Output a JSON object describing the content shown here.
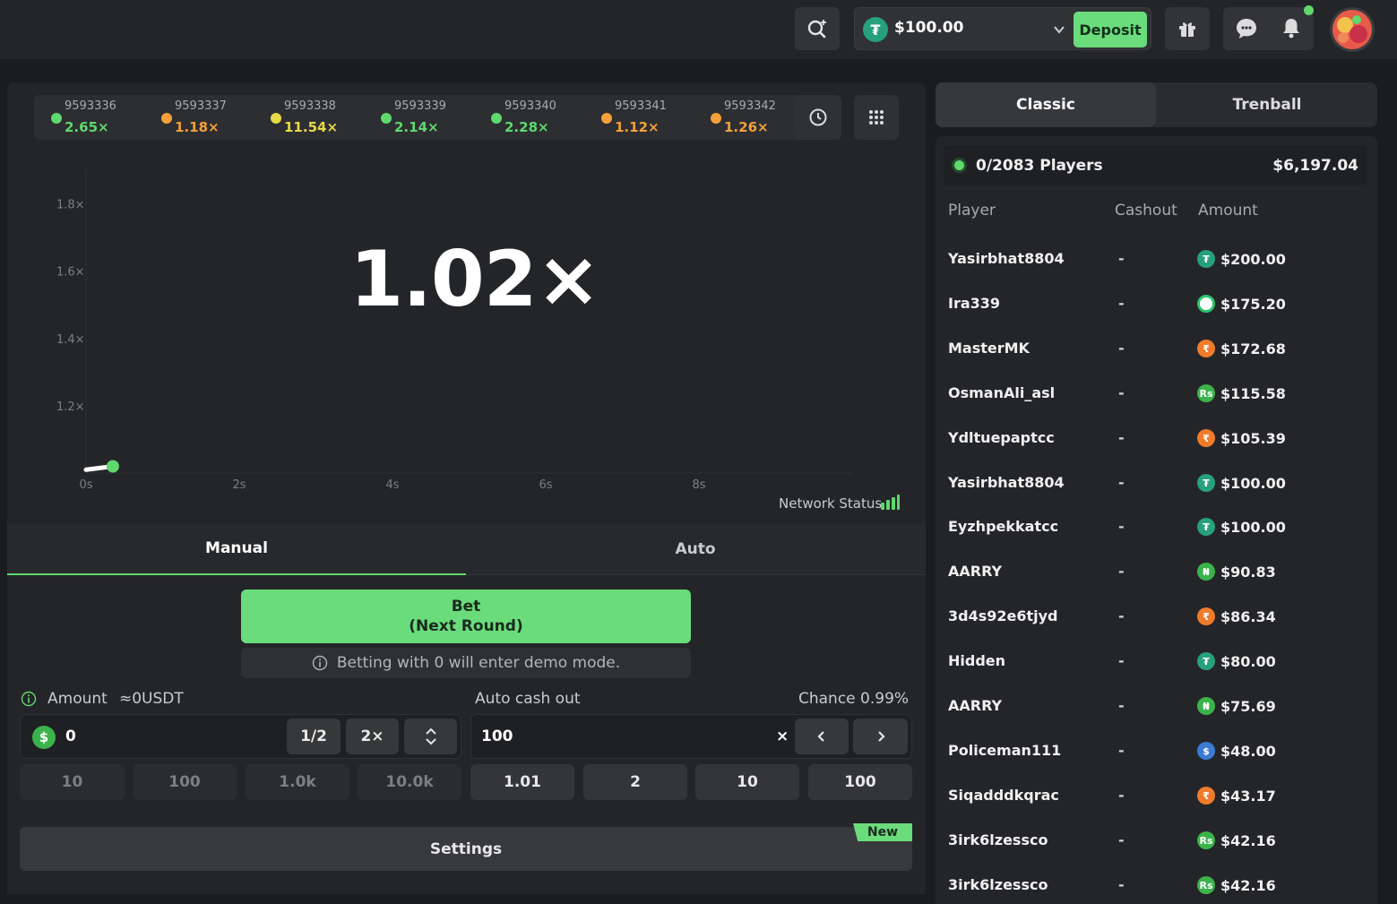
{
  "topbar": {
    "balance": "$100.00",
    "deposit_label": "Deposit",
    "currency_symbol": "₮"
  },
  "history": [
    {
      "id": "9593336",
      "mult": "2.65×",
      "color": "#5fd86e"
    },
    {
      "id": "9593337",
      "mult": "1.18×",
      "color": "#f5a03a"
    },
    {
      "id": "9593338",
      "mult": "11.54×",
      "color": "#e6d94a"
    },
    {
      "id": "9593339",
      "mult": "2.14×",
      "color": "#5fd86e"
    },
    {
      "id": "9593340",
      "mult": "2.28×",
      "color": "#5fd86e"
    },
    {
      "id": "9593341",
      "mult": "1.12×",
      "color": "#f5a03a"
    },
    {
      "id": "9593342",
      "mult": "1.26×",
      "color": "#f5a03a"
    }
  ],
  "game": {
    "current_multiplier": "1.02×",
    "network_status_label": "Network Status"
  },
  "chart_data": {
    "type": "line",
    "x_ticks": [
      "0s",
      "2s",
      "4s",
      "6s",
      "8s"
    ],
    "y_ticks": [
      "1.2×",
      "1.4×",
      "1.6×",
      "1.8×"
    ],
    "xlim": [
      0,
      10
    ],
    "ylim": [
      1.0,
      1.9
    ],
    "series": [
      {
        "x": [
          0,
          0.35
        ],
        "y": [
          1.01,
          1.02
        ]
      }
    ]
  },
  "bet_tabs": {
    "manual": "Manual",
    "auto": "Auto"
  },
  "bet": {
    "button_line1": "Bet",
    "button_line2": "(Next Round)",
    "demo_note": "Betting with 0 will enter demo mode."
  },
  "amount": {
    "label": "Amount",
    "approx": "≈0USDT",
    "value": "0",
    "currency_symbol": "$",
    "half": "1/2",
    "double": "2×",
    "quick": [
      "10",
      "100",
      "1.0k",
      "10.0k"
    ]
  },
  "autocashout": {
    "label": "Auto cash out",
    "chance": "Chance 0.99%",
    "value": "100",
    "suffix": "×",
    "quick": [
      "1.01",
      "2",
      "10",
      "100"
    ]
  },
  "settings": {
    "label": "Settings",
    "badge": "New"
  },
  "right_tabs": {
    "classic": "Classic",
    "trenball": "Trenball"
  },
  "players": {
    "count": "0/2083 Players",
    "total": "$6,197.04",
    "headers": {
      "player": "Player",
      "cashout": "Cashout",
      "amount": "Amount"
    },
    "rows": [
      {
        "name": "Yasirbhat8804",
        "cashout": "-",
        "amount": "$200.00",
        "coin": "t",
        "glyph": "₮"
      },
      {
        "name": "Ira339",
        "cashout": "-",
        "amount": "$175.20",
        "coin": "ring",
        "glyph": ""
      },
      {
        "name": "MasterMK",
        "cashout": "-",
        "amount": "$172.68",
        "coin": "o",
        "glyph": "₹"
      },
      {
        "name": "OsmanAli_asl",
        "cashout": "-",
        "amount": "$115.58",
        "coin": "g",
        "glyph": "Rs"
      },
      {
        "name": "Ydltuepaptcc",
        "cashout": "-",
        "amount": "$105.39",
        "coin": "o",
        "glyph": "₹"
      },
      {
        "name": "Yasirbhat8804",
        "cashout": "-",
        "amount": "$100.00",
        "coin": "t",
        "glyph": "₮"
      },
      {
        "name": "Eyzhpekkatcc",
        "cashout": "-",
        "amount": "$100.00",
        "coin": "t",
        "glyph": "₮"
      },
      {
        "name": "AARRY",
        "cashout": "-",
        "amount": "$90.83",
        "coin": "g",
        "glyph": "₦"
      },
      {
        "name": "3d4s92e6tjyd",
        "cashout": "-",
        "amount": "$86.34",
        "coin": "o",
        "glyph": "₹"
      },
      {
        "name": "Hidden",
        "cashout": "-",
        "amount": "$80.00",
        "coin": "t",
        "glyph": "₮"
      },
      {
        "name": "AARRY",
        "cashout": "-",
        "amount": "$75.69",
        "coin": "g",
        "glyph": "₦"
      },
      {
        "name": "Policeman111",
        "cashout": "-",
        "amount": "$48.00",
        "coin": "b",
        "glyph": "$"
      },
      {
        "name": "Siqadddkqrac",
        "cashout": "-",
        "amount": "$43.17",
        "coin": "o",
        "glyph": "₹"
      },
      {
        "name": "3irk6lzessco",
        "cashout": "-",
        "amount": "$42.16",
        "coin": "g",
        "glyph": "Rs"
      },
      {
        "name": "3irk6lzessco",
        "cashout": "-",
        "amount": "$42.16",
        "coin": "g",
        "glyph": "Rs"
      }
    ]
  }
}
